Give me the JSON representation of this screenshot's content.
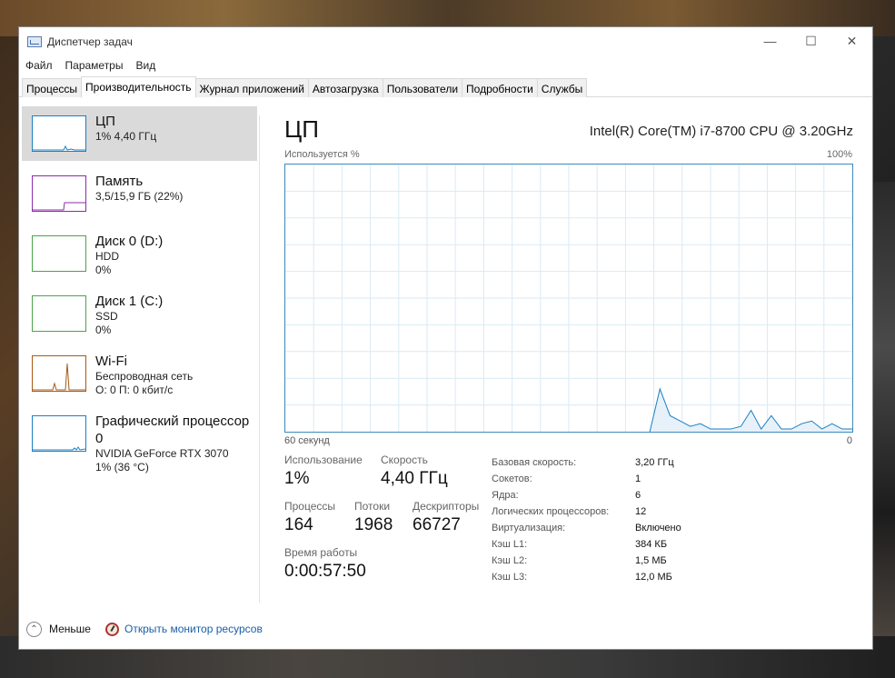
{
  "window": {
    "title": "Диспетчер задач"
  },
  "menu": [
    "Файл",
    "Параметры",
    "Вид"
  ],
  "tabs": [
    "Процессы",
    "Производительность",
    "Журнал приложений",
    "Автозагрузка",
    "Пользователи",
    "Подробности",
    "Службы"
  ],
  "active_tab": "Производительность",
  "sidebar": [
    {
      "name": "ЦП",
      "line1": "1% 4,40 ГГц",
      "line2": "",
      "color": "#1d7fc1",
      "selected": true
    },
    {
      "name": "Память",
      "line1": "3,5/15,9 ГБ (22%)",
      "line2": "",
      "color": "#8b2ca8",
      "selected": false
    },
    {
      "name": "Диск 0 (D:)",
      "line1": "HDD",
      "line2": "0%",
      "color": "#4ca34a",
      "selected": false
    },
    {
      "name": "Диск 1 (C:)",
      "line1": "SSD",
      "line2": "0%",
      "color": "#4ca34a",
      "selected": false
    },
    {
      "name": "Wi-Fi",
      "line1": "Беспроводная сеть",
      "line2": "О: 0 П: 0 кбит/с",
      "color": "#a75a14",
      "selected": false
    },
    {
      "name": "Графический процессор 0",
      "line1": "NVIDIA GeForce RTX 3070",
      "line2": "1% (36 °C)",
      "color": "#1d7fc1",
      "selected": false
    }
  ],
  "main": {
    "title": "ЦП",
    "cpu_model": "Intel(R) Core(TM) i7-8700 CPU @ 3.20GHz",
    "graph_top_left": "Используется %",
    "graph_top_right": "100%",
    "graph_bottom_left": "60 секунд",
    "graph_bottom_right": "0",
    "usage_series_percent": [
      0,
      0,
      0,
      0,
      0,
      0,
      0,
      0,
      0,
      0,
      0,
      0,
      0,
      0,
      0,
      0,
      0,
      0,
      0,
      0,
      0,
      0,
      0,
      0,
      0,
      0,
      0,
      0,
      0,
      0,
      0,
      0,
      0,
      0,
      0,
      0,
      0,
      16,
      6,
      4,
      2,
      3,
      1,
      1,
      1,
      2,
      8,
      1,
      6,
      1,
      1,
      3,
      4,
      1,
      3,
      1,
      1
    ]
  },
  "stats": {
    "usage_label": "Использование",
    "usage_value": "1%",
    "speed_label": "Скорость",
    "speed_value": "4,40 ГГц",
    "processes_label": "Процессы",
    "processes_value": "164",
    "threads_label": "Потоки",
    "threads_value": "1968",
    "handles_label": "Дескрипторы",
    "handles_value": "66727",
    "uptime_label": "Время работы",
    "uptime_value": "0:00:57:50"
  },
  "specs": [
    {
      "k": "Базовая скорость:",
      "v": "3,20 ГГц"
    },
    {
      "k": "Сокетов:",
      "v": "1"
    },
    {
      "k": "Ядра:",
      "v": "6"
    },
    {
      "k": "Логических процессоров:",
      "v": "12"
    },
    {
      "k": "Виртуализация:",
      "v": "Включено"
    },
    {
      "k": "Кэш L1:",
      "v": "384 КБ"
    },
    {
      "k": "Кэш L2:",
      "v": "1,5 МБ"
    },
    {
      "k": "Кэш L3:",
      "v": "12,0 МБ"
    }
  ],
  "footer": {
    "fewer": "Меньше",
    "resmon": "Открыть монитор ресурсов"
  }
}
